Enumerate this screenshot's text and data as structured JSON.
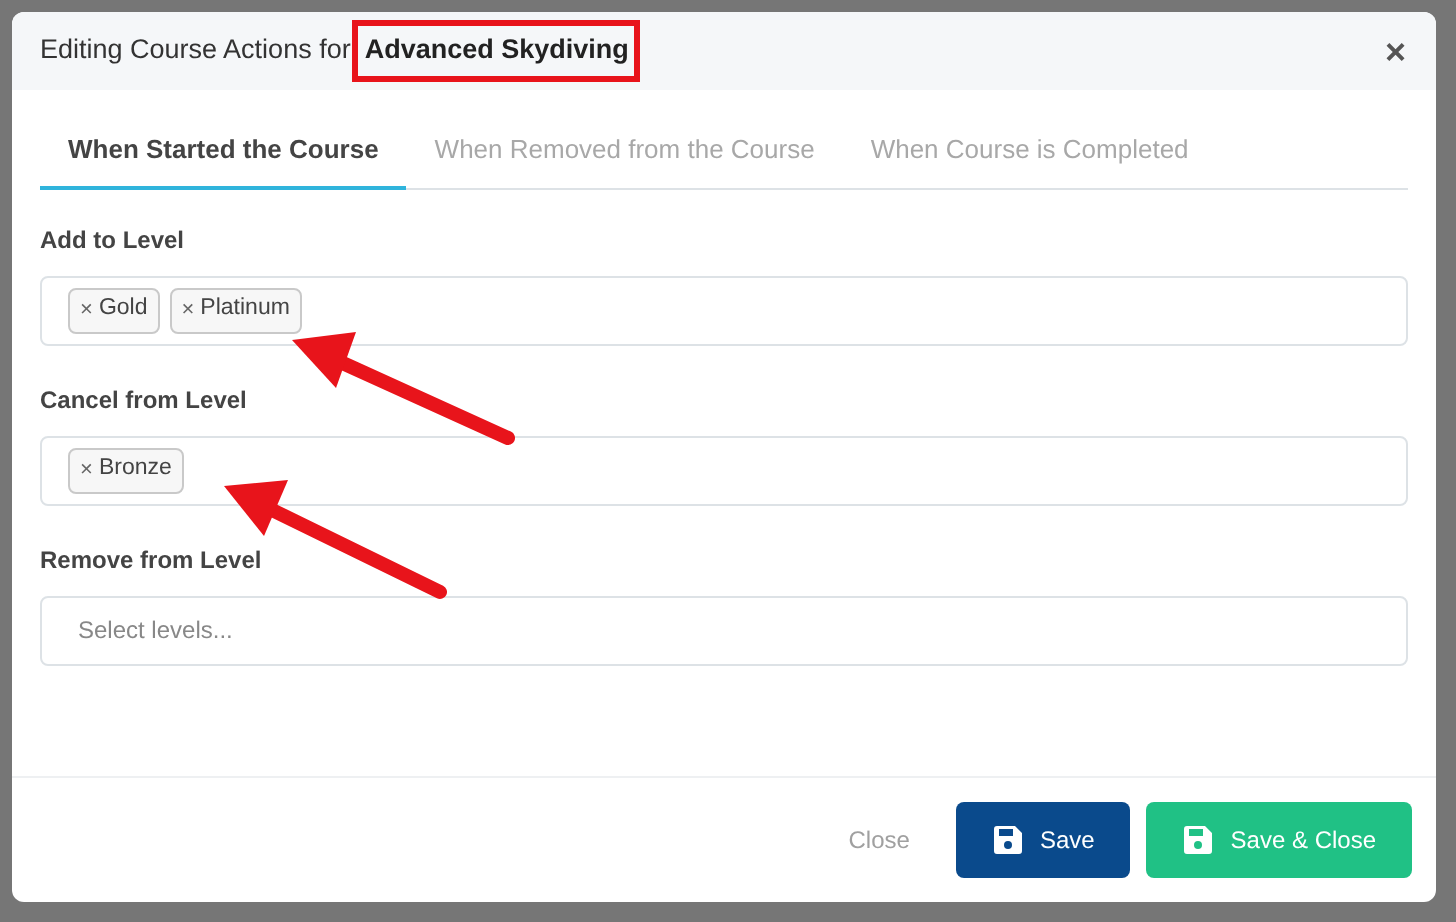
{
  "dialog": {
    "title_prefix": "Editing Course Actions for",
    "course_name": "Advanced Skydiving",
    "close_glyph": "×"
  },
  "tabs": [
    {
      "label": "When Started the Course",
      "selected": true
    },
    {
      "label": "When Removed from the Course",
      "selected": false
    },
    {
      "label": "When Course is Completed",
      "selected": false
    }
  ],
  "fields": [
    {
      "label": "Add to Level",
      "tags": [
        {
          "remove": "×",
          "label": "Gold"
        },
        {
          "remove": "×",
          "label": "Platinum"
        }
      ]
    },
    {
      "label": "Cancel from Level",
      "tags": [
        {
          "remove": "×",
          "label": "Bronze"
        }
      ]
    },
    {
      "label": "Remove from Level",
      "placeholder": "Select levels..."
    }
  ],
  "footer": {
    "close": "Close",
    "save": "Save",
    "save_close": "Save & Close"
  }
}
